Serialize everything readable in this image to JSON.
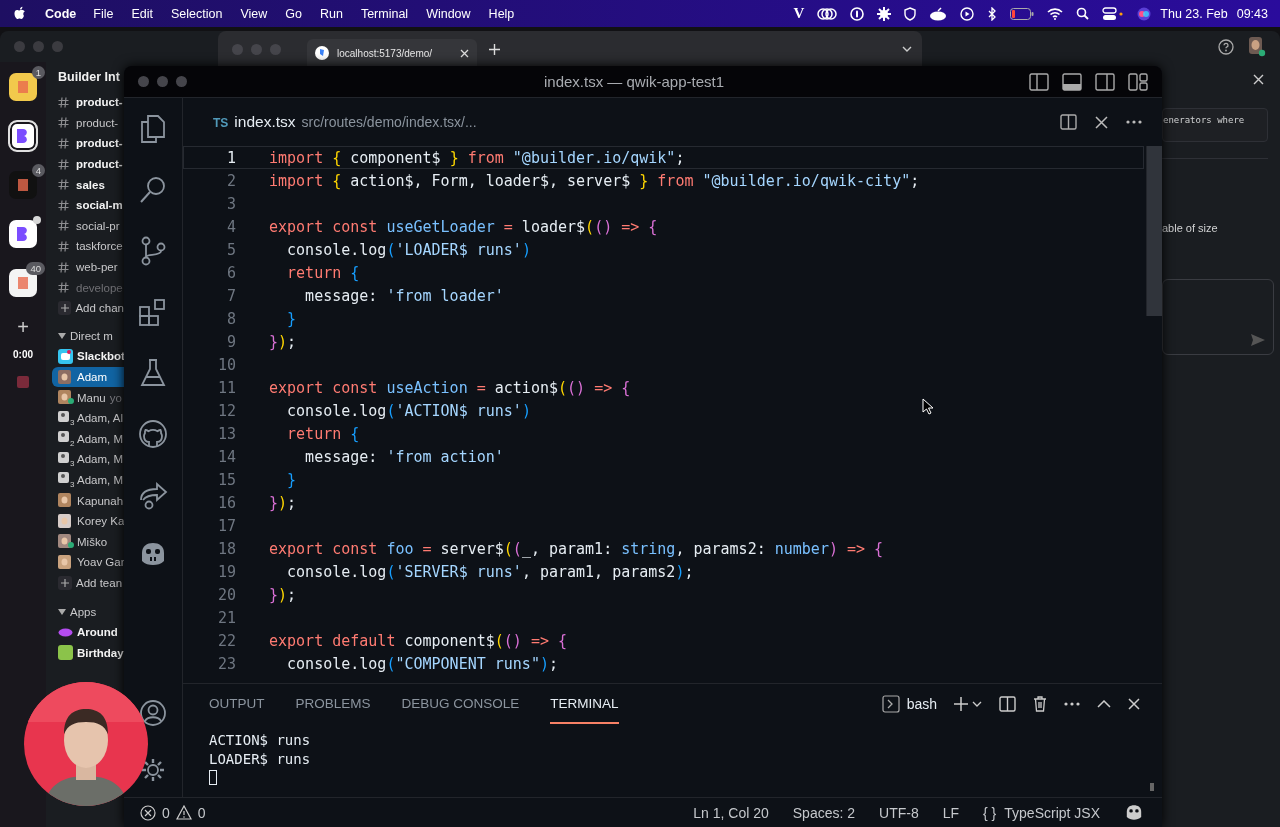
{
  "menu_bar": {
    "app": "Code",
    "items": [
      "File",
      "Edit",
      "Selection",
      "View",
      "Go",
      "Run",
      "Terminal",
      "Window",
      "Help"
    ],
    "brand_letter": "V",
    "date": "Thu 23. Feb",
    "time": "09:43"
  },
  "slack": {
    "team": "Builder Int",
    "workspaces": [
      {
        "badge": "1",
        "selected": false,
        "dot": false,
        "color": "#f2c94c"
      },
      {
        "selected": true,
        "dot": false,
        "color": "#ffffff"
      },
      {
        "badge": "4",
        "selected": false,
        "dot": false,
        "color": "#111111"
      },
      {
        "selected": false,
        "dot": true,
        "color": "#ffffff"
      },
      {
        "badge": "40",
        "selected": false,
        "dot": false,
        "color": "#f4f4f4"
      }
    ],
    "add_label": "+",
    "timer": "0:00",
    "channels": [
      {
        "name": "product-",
        "unread": true,
        "muted": false
      },
      {
        "name": "product-",
        "unread": false,
        "muted": false
      },
      {
        "name": "product-",
        "unread": true,
        "muted": false
      },
      {
        "name": "product-",
        "unread": true,
        "muted": false
      },
      {
        "name": "sales",
        "unread": true,
        "muted": false
      },
      {
        "name": "social-m",
        "unread": true,
        "muted": false
      },
      {
        "name": "social-pr",
        "unread": false,
        "muted": false
      },
      {
        "name": "taskforce",
        "unread": false,
        "muted": false
      },
      {
        "name": "web-per",
        "unread": false,
        "muted": false
      },
      {
        "name": "develope",
        "unread": false,
        "muted": true
      }
    ],
    "add_channel": "Add chan",
    "dm_section": {
      "title": "Direct m",
      "expanded": true
    },
    "dms": [
      {
        "name": "Slackbot",
        "kind": "bot",
        "unread": true,
        "selected": false,
        "online": false
      },
      {
        "name": "Adam",
        "kind": "person",
        "unread": false,
        "selected": true,
        "online": false
      },
      {
        "name": "Manu",
        "note": "yo",
        "kind": "person",
        "unread": false,
        "selected": false,
        "online": true
      },
      {
        "name": "Adam, Al",
        "kind": "group",
        "members": "3",
        "unread": false,
        "selected": false,
        "online": false
      },
      {
        "name": "Adam, M",
        "kind": "group",
        "members": "2",
        "unread": false,
        "selected": false,
        "online": false
      },
      {
        "name": "Adam, M",
        "kind": "group",
        "members": "3",
        "unread": false,
        "selected": false,
        "online": false
      },
      {
        "name": "Adam, M",
        "kind": "group",
        "members": "3",
        "unread": false,
        "selected": false,
        "online": false
      },
      {
        "name": "Kapunah",
        "kind": "person",
        "unread": false,
        "selected": false,
        "online": false
      },
      {
        "name": "Korey Ka",
        "kind": "person",
        "unread": false,
        "selected": false,
        "online": false
      },
      {
        "name": "Miško",
        "kind": "person",
        "unread": false,
        "selected": false,
        "online": true
      },
      {
        "name": "Yoav Gar",
        "kind": "person",
        "unread": false,
        "selected": false,
        "online": false
      }
    ],
    "add_teammate": "Add tean",
    "apps_section": {
      "title": "Apps",
      "expanded": true
    },
    "apps": [
      {
        "name": "Around",
        "unread": true
      },
      {
        "name": "Birthday",
        "unread": true
      }
    ],
    "thread_panel": {
      "snippet": "enerators where",
      "text": "able of size"
    }
  },
  "browser": {
    "tab": "localhost:5173/demo/"
  },
  "vscode": {
    "title": "index.tsx — qwik-app-test1",
    "tab": {
      "lang": "TS",
      "name": "index.tsx",
      "path": "src/routes/demo/index.tsx/..."
    },
    "lines": [
      {
        "number": "1",
        "current": true,
        "tokens": [
          {
            "kind": "keyword",
            "text": "import "
          },
          {
            "kind": "bracket1",
            "text": "{"
          },
          {
            "kind": "plain",
            "text": " component$ "
          },
          {
            "kind": "bracket1",
            "text": "} "
          },
          {
            "kind": "keyword",
            "text": "from "
          },
          {
            "kind": "string",
            "text": "\"@builder.io/qwik\""
          },
          {
            "kind": "plain",
            "text": ";"
          }
        ]
      },
      {
        "number": "2",
        "current": false,
        "tokens": [
          {
            "kind": "keyword",
            "text": "import "
          },
          {
            "kind": "bracket1",
            "text": "{"
          },
          {
            "kind": "plain",
            "text": " action$, Form, loader$, server$ "
          },
          {
            "kind": "bracket1",
            "text": "} "
          },
          {
            "kind": "keyword",
            "text": "from "
          },
          {
            "kind": "string",
            "text": "\"@builder.io/qwik-city\""
          },
          {
            "kind": "plain",
            "text": ";"
          }
        ]
      },
      {
        "number": "3",
        "current": false
      },
      {
        "number": "4",
        "current": false,
        "tokens": [
          {
            "kind": "keyword",
            "text": "export const "
          },
          {
            "kind": "function",
            "text": "useGetLoader "
          },
          {
            "kind": "keyword",
            "text": "="
          },
          {
            "kind": "plain",
            "text": " loader$"
          },
          {
            "kind": "bracket1",
            "text": "("
          },
          {
            "kind": "bracket2",
            "text": "() "
          },
          {
            "kind": "keyword",
            "text": "=> "
          },
          {
            "kind": "bracket2",
            "text": "{"
          }
        ]
      },
      {
        "number": "5",
        "current": false,
        "tokens": [
          {
            "kind": "plain",
            "text": "  console.log"
          },
          {
            "kind": "bracket3",
            "text": "("
          },
          {
            "kind": "string",
            "text": "'LOADER$ runs'"
          },
          {
            "kind": "bracket3",
            "text": ")"
          }
        ]
      },
      {
        "number": "6",
        "current": false,
        "tokens": [
          {
            "kind": "keyword",
            "text": "  return "
          },
          {
            "kind": "bracket3",
            "text": "{"
          }
        ]
      },
      {
        "number": "7",
        "current": false,
        "tokens": [
          {
            "kind": "plain",
            "text": "    message: "
          },
          {
            "kind": "string",
            "text": "'from loader'"
          }
        ]
      },
      {
        "number": "8",
        "current": false,
        "tokens": [
          {
            "kind": "bracket3",
            "text": "  }"
          }
        ]
      },
      {
        "number": "9",
        "current": false,
        "tokens": [
          {
            "kind": "bracket2",
            "text": "}"
          },
          {
            "kind": "bracket1",
            "text": ")"
          },
          {
            "kind": "plain",
            "text": ";"
          }
        ]
      },
      {
        "number": "10",
        "current": false
      },
      {
        "number": "11",
        "current": false,
        "tokens": [
          {
            "kind": "keyword",
            "text": "export const "
          },
          {
            "kind": "function",
            "text": "useAction "
          },
          {
            "kind": "keyword",
            "text": "="
          },
          {
            "kind": "plain",
            "text": " action$"
          },
          {
            "kind": "bracket1",
            "text": "("
          },
          {
            "kind": "bracket2",
            "text": "() "
          },
          {
            "kind": "keyword",
            "text": "=> "
          },
          {
            "kind": "bracket2",
            "text": "{"
          }
        ]
      },
      {
        "number": "12",
        "current": false,
        "tokens": [
          {
            "kind": "plain",
            "text": "  console.log"
          },
          {
            "kind": "bracket3",
            "text": "("
          },
          {
            "kind": "string",
            "text": "'ACTION$ runs'"
          },
          {
            "kind": "bracket3",
            "text": ")"
          }
        ]
      },
      {
        "number": "13",
        "current": false,
        "tokens": [
          {
            "kind": "keyword",
            "text": "  return "
          },
          {
            "kind": "bracket3",
            "text": "{"
          }
        ]
      },
      {
        "number": "14",
        "current": false,
        "tokens": [
          {
            "kind": "plain",
            "text": "    message: "
          },
          {
            "kind": "string",
            "text": "'from action'"
          }
        ]
      },
      {
        "number": "15",
        "current": false,
        "tokens": [
          {
            "kind": "bracket3",
            "text": "  }"
          }
        ]
      },
      {
        "number": "16",
        "current": false,
        "tokens": [
          {
            "kind": "bracket2",
            "text": "}"
          },
          {
            "kind": "bracket1",
            "text": ")"
          },
          {
            "kind": "plain",
            "text": ";"
          }
        ]
      },
      {
        "number": "17",
        "current": false
      },
      {
        "number": "18",
        "current": false,
        "tokens": [
          {
            "kind": "keyword",
            "text": "export const "
          },
          {
            "kind": "function",
            "text": "foo "
          },
          {
            "kind": "keyword",
            "text": "="
          },
          {
            "kind": "plain",
            "text": " server$"
          },
          {
            "kind": "bracket1",
            "text": "("
          },
          {
            "kind": "bracket2",
            "text": "("
          },
          {
            "kind": "plain",
            "text": "_, param1: "
          },
          {
            "kind": "type",
            "text": "string"
          },
          {
            "kind": "plain",
            "text": ", params2: "
          },
          {
            "kind": "type",
            "text": "number"
          },
          {
            "kind": "bracket2",
            "text": ") "
          },
          {
            "kind": "keyword",
            "text": "=> "
          },
          {
            "kind": "bracket2",
            "text": "{"
          }
        ]
      },
      {
        "number": "19",
        "current": false,
        "tokens": [
          {
            "kind": "plain",
            "text": "  console.log"
          },
          {
            "kind": "bracket3",
            "text": "("
          },
          {
            "kind": "string",
            "text": "'SERVER$ runs'"
          },
          {
            "kind": "plain",
            "text": ", param1, params2"
          },
          {
            "kind": "bracket3",
            "text": ")"
          },
          {
            "kind": "plain",
            "text": ";"
          }
        ]
      },
      {
        "number": "20",
        "current": false,
        "tokens": [
          {
            "kind": "bracket2",
            "text": "}"
          },
          {
            "kind": "bracket1",
            "text": ")"
          },
          {
            "kind": "plain",
            "text": ";"
          }
        ]
      },
      {
        "number": "21",
        "current": false
      },
      {
        "number": "22",
        "current": false,
        "tokens": [
          {
            "kind": "keyword",
            "text": "export default"
          },
          {
            "kind": "plain",
            "text": " component$"
          },
          {
            "kind": "bracket1",
            "text": "("
          },
          {
            "kind": "bracket2",
            "text": "() "
          },
          {
            "kind": "keyword",
            "text": "=> "
          },
          {
            "kind": "bracket2",
            "text": "{"
          }
        ]
      },
      {
        "number": "23",
        "current": false,
        "tokens": [
          {
            "kind": "plain",
            "text": "  console.log"
          },
          {
            "kind": "bracket3",
            "text": "("
          },
          {
            "kind": "string",
            "text": "\"COMPONENT runs\""
          },
          {
            "kind": "bracket3",
            "text": ")"
          },
          {
            "kind": "plain",
            "text": ";"
          }
        ]
      }
    ],
    "panel_tabs": [
      {
        "label": "OUTPUT",
        "selected": false
      },
      {
        "label": "PROBLEMS",
        "selected": false
      },
      {
        "label": "DEBUG CONSOLE",
        "selected": false
      },
      {
        "label": "TERMINAL",
        "selected": true
      }
    ],
    "shell": "bash",
    "terminal_lines": [
      "ACTION$ runs",
      "LOADER$ runs"
    ],
    "status": {
      "errors": "0",
      "warnings": "0",
      "position": "Ln 1, Col 20",
      "indent": "Spaces: 2",
      "encoding": "UTF-8",
      "eol": "LF",
      "language_icon": "{ }",
      "language": "TypeScript JSX"
    }
  }
}
